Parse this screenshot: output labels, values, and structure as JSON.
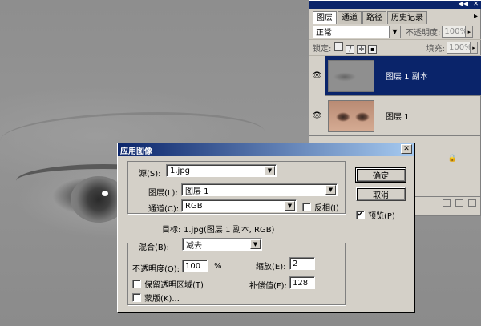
{
  "layers_panel": {
    "tabs": [
      "图层",
      "通道",
      "路径",
      "历史记录"
    ],
    "blend_mode": "正常",
    "opacity_label": "不透明度:",
    "opacity_value": "100%",
    "lock_label": "锁定:",
    "fill_label": "填充:",
    "fill_value": "100%",
    "layers": [
      {
        "name": "图层 1 副本",
        "selected": true
      },
      {
        "name": "图层 1",
        "selected": false
      }
    ]
  },
  "dialog": {
    "title": "应用图像",
    "source_label": "源(S):",
    "source_value": "1.jpg",
    "layer_label": "图层(L):",
    "layer_value": "图层 1",
    "channel_label": "通道(C):",
    "channel_value": "RGB",
    "invert_label": "反相(I)",
    "target_label": "目标:",
    "target_value": "1.jpg(图层 1 副本, RGB)",
    "blending_label": "混合(B):",
    "blending_value": "减去",
    "opacity_label": "不透明度(O):",
    "opacity_value": "100",
    "opacity_unit": "%",
    "scale_label": "缩放(E):",
    "scale_value": "2",
    "offset_label": "补偿值(F):",
    "offset_value": "128",
    "preserve_transparency_label": "保留透明区域(T)",
    "mask_label": "蒙版(K)...",
    "ok_label": "确定",
    "cancel_label": "取消",
    "preview_label": "预览(P)",
    "preview_checked": true
  }
}
